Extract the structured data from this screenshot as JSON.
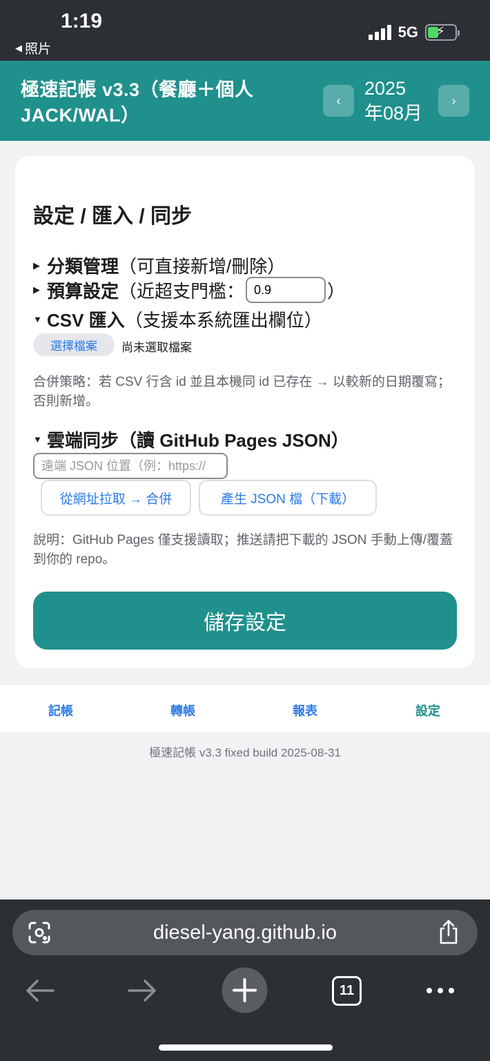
{
  "status": {
    "time": "1:19",
    "back_label": "照片",
    "network": "5G"
  },
  "header": {
    "title": "極速記帳 v3.3（餐廳＋個人 JACK/WAL）",
    "year": "2025",
    "month": "年08月",
    "prev_label": "‹",
    "next_label": "›"
  },
  "settings": {
    "title": "設定 / 匯入 / 同步",
    "category": {
      "bold": "分類管理",
      "rest": "（可直接新增/刪除）"
    },
    "budget": {
      "bold": "預算設定",
      "rest": "（近超支門檻：",
      "close": "）",
      "threshold": "0.9"
    },
    "csv": {
      "bold": "CSV 匯入",
      "rest": "（支援本系統匯出欄位）",
      "choose_file": "選擇檔案",
      "no_file": "尚未選取檔案"
    },
    "merge_note": "合併策略：若 CSV 行含 id 並且本機同 id 已存在 → 以較新的日期覆寫；否則新增。",
    "cloud": {
      "bold": "雲端同步（讀 GitHub Pages JSON）",
      "url_placeholder": "遠端 JSON 位置（例：https://",
      "pull_merge": "從網址拉取 → 合併",
      "generate_json": "產生 JSON 檔（下載）"
    },
    "cloud_note": "說明：GitHub Pages 僅支援讀取；推送請把下載的 JSON 手動上傳/覆蓋到你的 repo。",
    "save": "儲存設定"
  },
  "tabs": [
    "記帳",
    "轉帳",
    "報表",
    "設定"
  ],
  "active_tab": "設定",
  "build_info": "極速記帳 v3.3 fixed build 2025-08-31",
  "browser": {
    "url": "diesel-yang.github.io",
    "tab_count": "11"
  },
  "colors": {
    "accent": "#20908c",
    "link": "#2c7be5"
  }
}
